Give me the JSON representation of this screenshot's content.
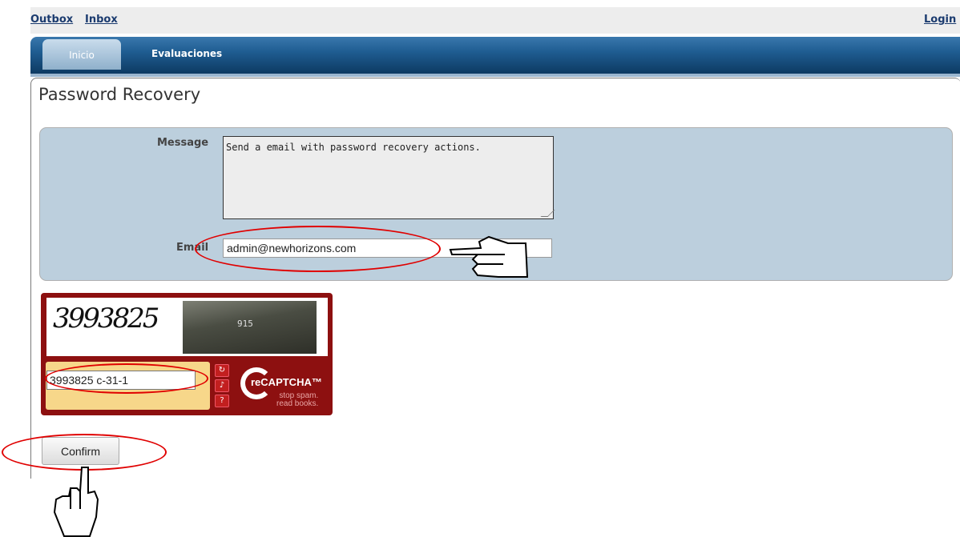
{
  "topbar": {
    "outbox": "Outbox",
    "inbox": "Inbox",
    "login": "Login"
  },
  "nav": {
    "tabs": [
      {
        "label": "Inicio",
        "active": true
      },
      {
        "label": "Evaluaciones",
        "active": false
      }
    ]
  },
  "page": {
    "title": "Password Recovery"
  },
  "form": {
    "message_label": "Message",
    "message_value": "Send a email with password recovery actions.",
    "email_label": "Email",
    "email_value": "admin@newhorizons.com"
  },
  "captcha": {
    "challenge_text": "3993825",
    "photo_number": "915",
    "input_value": "3993825 c-31-1",
    "brand": "reCAPTCHA™",
    "tagline_1": "stop spam.",
    "tagline_2": "read books.",
    "buttons": [
      "refresh-icon",
      "audio-icon",
      "help-icon"
    ]
  },
  "actions": {
    "confirm_label": "Confirm"
  },
  "colors": {
    "nav_dark": "#0d3a62",
    "form_bg": "#bccfdd",
    "captcha_red": "#8d1010",
    "annotation_red": "#e00000"
  }
}
